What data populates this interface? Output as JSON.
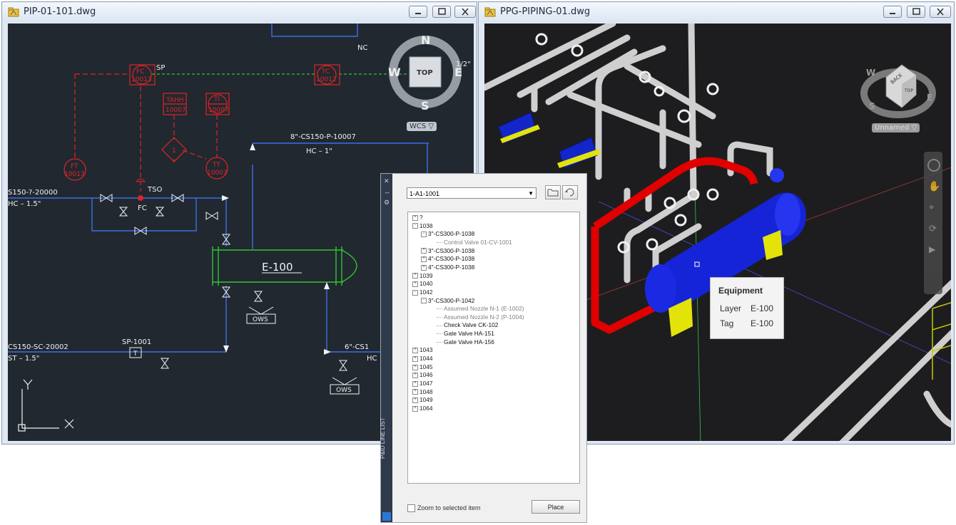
{
  "left_window": {
    "title": "PIP-01-101.dwg",
    "labels": {
      "fc": "FC",
      "fc_num": "10013",
      "sp": "SP",
      "tc": "TC",
      "tc_num": "10012",
      "tahh": "TAHH",
      "tahh_num": "10007",
      "ti": "TI",
      "ti_num": "10007",
      "ft": "FT",
      "ft_num": "10013",
      "tt": "TT",
      "tt_num": "10007",
      "diamond": "1",
      "line_a": "S150-?-20000",
      "line_a2": "HC  –  1.5\"",
      "line_b": "8\"-CS150-P-10007",
      "line_b2": "HC  –  1\"",
      "tso": "TSO",
      "fc_valve": "FC",
      "vessel": "E-100",
      "ows1": "OWS",
      "ows2": "OWS",
      "sp1001": "SP-1001",
      "t_box": "T",
      "line_c": "CS150-SC-20002",
      "line_c2": "ST  –  1.5\"",
      "line_d": "6\"-CS1",
      "line_d2": "HC",
      "nc": "NC"
    },
    "viewcube": {
      "n": "N",
      "s": "S",
      "e": "E",
      "w": "W",
      "top": "TOP",
      "wcs": "WCS",
      "half": "1/2\""
    },
    "ucs": {
      "x": "X",
      "y": "Y"
    },
    "colors": {
      "background": "#212830",
      "red": "#e02424",
      "green": "#2fc62f",
      "blue": "#3a6fe6",
      "white": "#f2f2f2"
    }
  },
  "right_window": {
    "title": "PPG-PIPING-01.dwg",
    "viewcube": {
      "face": "TOP",
      "side": "BACK",
      "e": "E",
      "w": "W",
      "s": "S"
    },
    "view_label": "Unnamed",
    "colors": {
      "background": "#1d1d1f",
      "pipe": "#d6d6d6",
      "equipment": "#1326c8",
      "support": "#e3e30a",
      "highlight": "#e00000"
    }
  },
  "palette": {
    "strip_title": "P&ID LINE LIST",
    "dropdown_value": "1-A1-1001",
    "open_icon": "folder-open-icon",
    "refresh_icon": "refresh-icon",
    "tree": [
      {
        "label": "?",
        "level": 0,
        "exp": "+",
        "style": "normal"
      },
      {
        "label": "1038",
        "level": 0,
        "exp": "-",
        "style": "normal"
      },
      {
        "label": "3\"-CS300-P-1038",
        "level": 1,
        "exp": "-",
        "style": "bold"
      },
      {
        "label": "Control Valve 01-CV-1001",
        "level": 2,
        "exp": "",
        "style": "gray"
      },
      {
        "label": "3\"-CS300-P-1038",
        "level": 1,
        "exp": "+",
        "style": "bold"
      },
      {
        "label": "4\"-CS300-P-1038",
        "level": 1,
        "exp": "+",
        "style": "bold"
      },
      {
        "label": "4\"-CS300-P-1038",
        "level": 1,
        "exp": "+",
        "style": "bold"
      },
      {
        "label": "1039",
        "level": 0,
        "exp": "+",
        "style": "normal"
      },
      {
        "label": "1040",
        "level": 0,
        "exp": "+",
        "style": "normal"
      },
      {
        "label": "1042",
        "level": 0,
        "exp": "-",
        "style": "normal"
      },
      {
        "label": "3\"-CS300-P-1042",
        "level": 1,
        "exp": "-",
        "style": "bold"
      },
      {
        "label": "Assumed Nozzle N-1 (E-1002)",
        "level": 2,
        "exp": "",
        "style": "gray"
      },
      {
        "label": "Assumed Nozzle N-2 (P-1004)",
        "level": 2,
        "exp": "",
        "style": "gray"
      },
      {
        "label": "Check Valve CK-102",
        "level": 2,
        "exp": "",
        "style": "bold"
      },
      {
        "label": "Gate Valve HA-151",
        "level": 2,
        "exp": "",
        "style": "bold"
      },
      {
        "label": "Gate Valve HA-156",
        "level": 2,
        "exp": "",
        "style": "bold"
      },
      {
        "label": "1043",
        "level": 0,
        "exp": "+",
        "style": "normal"
      },
      {
        "label": "1044",
        "level": 0,
        "exp": "+",
        "style": "normal"
      },
      {
        "label": "1045",
        "level": 0,
        "exp": "+",
        "style": "normal"
      },
      {
        "label": "1046",
        "level": 0,
        "exp": "+",
        "style": "normal"
      },
      {
        "label": "1047",
        "level": 0,
        "exp": "+",
        "style": "normal"
      },
      {
        "label": "1048",
        "level": 0,
        "exp": "+",
        "style": "normal"
      },
      {
        "label": "1049",
        "level": 0,
        "exp": "+",
        "style": "normal"
      },
      {
        "label": "1064",
        "level": 0,
        "exp": "+",
        "style": "normal"
      }
    ],
    "zoom_label": "Zoom to selected item",
    "zoom_checked": false,
    "place_label": "Place"
  },
  "tooltip": {
    "title": "Equipment",
    "rows": [
      {
        "key": "Layer",
        "value": "E-100"
      },
      {
        "key": "Tag",
        "value": "E-100"
      }
    ]
  }
}
